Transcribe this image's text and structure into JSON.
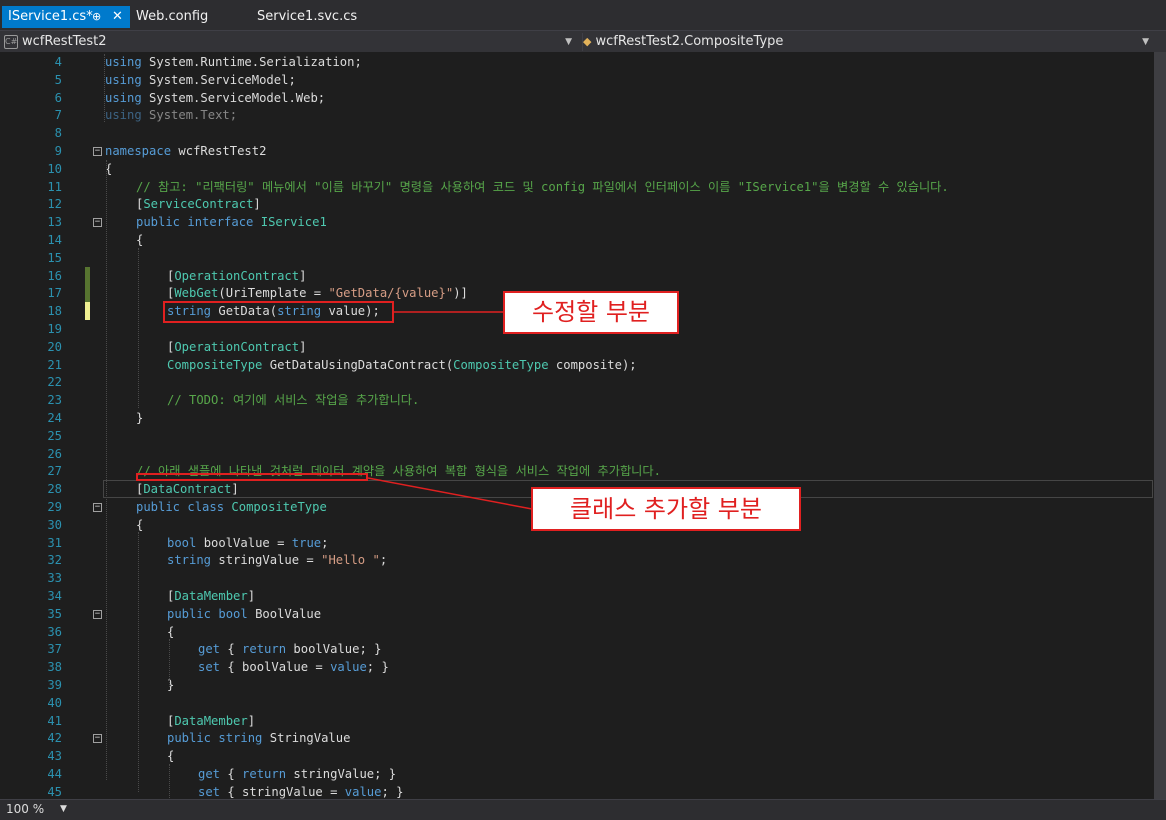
{
  "tabs": [
    {
      "label": "IService1.cs*",
      "pin": "⊕",
      "close": "✕",
      "active": true
    },
    {
      "label": "Web.config",
      "active": false
    },
    {
      "label": "Service1.svc.cs",
      "active": false
    }
  ],
  "navbar": {
    "project": "wcfRestTest2",
    "member": "wcfRestTest2.CompositeType",
    "project_icon": "csharp-project-icon",
    "member_icon": "class-icon"
  },
  "code_lines": [
    {
      "n": "4",
      "indent": 0,
      "parts": [
        [
          "kw",
          "using"
        ],
        [
          "",
          "System.Runtime.Serialization;"
        ]
      ]
    },
    {
      "n": "5",
      "indent": 0,
      "parts": [
        [
          "kw",
          "using"
        ],
        [
          "",
          "System.ServiceModel;"
        ]
      ]
    },
    {
      "n": "6",
      "indent": 0,
      "parts": [
        [
          "kw",
          "using"
        ],
        [
          "",
          "System.ServiceModel.Web;"
        ]
      ]
    },
    {
      "n": "7",
      "indent": 0,
      "dim": true,
      "parts": [
        [
          "kw",
          "using"
        ],
        [
          "",
          "System.Text;"
        ]
      ]
    },
    {
      "n": "8",
      "indent": 0,
      "parts": []
    },
    {
      "n": "9",
      "indent": 0,
      "fold": "-",
      "parts": [
        [
          "kw",
          "namespace"
        ],
        [
          "",
          "wcfRestTest2"
        ]
      ]
    },
    {
      "n": "10",
      "indent": 0,
      "parts": [
        [
          "",
          "{"
        ]
      ]
    },
    {
      "n": "11",
      "indent": 4,
      "parts": [
        [
          "cm",
          "// 참고: \"리팩터링\" 메뉴에서 \"이름 바꾸기\" 명령을 사용하여 코드 및 config 파일에서 인터페이스 이름 \"IService1\"을 변경할 수 있습니다."
        ]
      ]
    },
    {
      "n": "12",
      "indent": 4,
      "parts": [
        [
          "",
          "["
        ],
        [
          "ty",
          "ServiceContract"
        ],
        [
          "",
          "]"
        ]
      ]
    },
    {
      "n": "13",
      "indent": 4,
      "fold": "-",
      "parts": [
        [
          "kw",
          "public interface"
        ],
        [
          "ty",
          "IService1"
        ]
      ]
    },
    {
      "n": "14",
      "indent": 4,
      "parts": [
        [
          "",
          "{"
        ]
      ]
    },
    {
      "n": "15",
      "indent": 8,
      "parts": []
    },
    {
      "n": "16",
      "indent": 8,
      "change": "saved",
      "parts": [
        [
          "",
          "["
        ],
        [
          "ty",
          "OperationContract"
        ],
        [
          "",
          "]"
        ]
      ]
    },
    {
      "n": "17",
      "indent": 8,
      "change": "saved",
      "parts": [
        [
          "",
          "["
        ],
        [
          "ty",
          "WebGet"
        ],
        [
          "",
          "(UriTemplate ="
        ],
        [
          "st",
          "\"GetData/{value}\""
        ],
        [
          "",
          ")]"
        ]
      ]
    },
    {
      "n": "18",
      "indent": 8,
      "change": "unsaved",
      "parts": [
        [
          "kw",
          "string"
        ],
        [
          "",
          "GetData("
        ],
        [
          "kw",
          "string"
        ],
        [
          "",
          "value);"
        ]
      ]
    },
    {
      "n": "19",
      "indent": 8,
      "parts": []
    },
    {
      "n": "20",
      "indent": 8,
      "parts": [
        [
          "",
          "["
        ],
        [
          "ty",
          "OperationContract"
        ],
        [
          "",
          "]"
        ]
      ]
    },
    {
      "n": "21",
      "indent": 8,
      "parts": [
        [
          "ty",
          "CompositeType"
        ],
        [
          "",
          "GetDataUsingDataContract("
        ],
        [
          "ty",
          "CompositeType"
        ],
        [
          "",
          "composite);"
        ]
      ]
    },
    {
      "n": "22",
      "indent": 8,
      "parts": []
    },
    {
      "n": "23",
      "indent": 8,
      "parts": [
        [
          "cm",
          "// TODO: 여기에 서비스 작업을 추가합니다."
        ]
      ]
    },
    {
      "n": "24",
      "indent": 4,
      "parts": [
        [
          "",
          "}"
        ]
      ]
    },
    {
      "n": "25",
      "indent": 4,
      "parts": []
    },
    {
      "n": "26",
      "indent": 4,
      "parts": []
    },
    {
      "n": "27",
      "indent": 4,
      "parts": [
        [
          "cm",
          "// 아래 샘플에 나타낸 것처럼 데이터 계약을 사용하여 복합 형식을 서비스 작업에 추가합니다."
        ]
      ]
    },
    {
      "n": "28",
      "indent": 4,
      "parts": [
        [
          "",
          "["
        ],
        [
          "ty",
          "DataContract"
        ],
        [
          "",
          "]"
        ]
      ]
    },
    {
      "n": "29",
      "indent": 4,
      "fold": "-",
      "parts": [
        [
          "kw",
          "public class"
        ],
        [
          "ty",
          "CompositeType"
        ]
      ]
    },
    {
      "n": "30",
      "indent": 4,
      "parts": [
        [
          "",
          "{"
        ]
      ]
    },
    {
      "n": "31",
      "indent": 8,
      "parts": [
        [
          "kw",
          "bool"
        ],
        [
          "",
          "boolValue ="
        ],
        [
          "kw",
          "true"
        ],
        [
          "",
          ";"
        ]
      ]
    },
    {
      "n": "32",
      "indent": 8,
      "parts": [
        [
          "kw",
          "string"
        ],
        [
          "",
          "stringValue ="
        ],
        [
          "st",
          "\"Hello \""
        ],
        [
          "",
          ";"
        ]
      ]
    },
    {
      "n": "33",
      "indent": 8,
      "parts": []
    },
    {
      "n": "34",
      "indent": 8,
      "parts": [
        [
          "",
          "["
        ],
        [
          "ty",
          "DataMember"
        ],
        [
          "",
          "]"
        ]
      ]
    },
    {
      "n": "35",
      "indent": 8,
      "fold": "-",
      "parts": [
        [
          "kw",
          "public bool"
        ],
        [
          "",
          "BoolValue"
        ]
      ]
    },
    {
      "n": "36",
      "indent": 8,
      "parts": [
        [
          "",
          "{"
        ]
      ]
    },
    {
      "n": "37",
      "indent": 12,
      "parts": [
        [
          "kw",
          "get"
        ],
        [
          "",
          "{"
        ],
        [
          "kw",
          "return"
        ],
        [
          "",
          "boolValue; }"
        ]
      ]
    },
    {
      "n": "38",
      "indent": 12,
      "parts": [
        [
          "kw",
          "set"
        ],
        [
          "",
          "{ boolValue ="
        ],
        [
          "kw",
          "value"
        ],
        [
          "",
          "; }"
        ]
      ]
    },
    {
      "n": "39",
      "indent": 8,
      "parts": [
        [
          "",
          "}"
        ]
      ]
    },
    {
      "n": "40",
      "indent": 8,
      "parts": []
    },
    {
      "n": "41",
      "indent": 8,
      "parts": [
        [
          "",
          "["
        ],
        [
          "ty",
          "DataMember"
        ],
        [
          "",
          "]"
        ]
      ]
    },
    {
      "n": "42",
      "indent": 8,
      "fold": "-",
      "parts": [
        [
          "kw",
          "public string"
        ],
        [
          "",
          "StringValue"
        ]
      ]
    },
    {
      "n": "43",
      "indent": 8,
      "parts": [
        [
          "",
          "{"
        ]
      ]
    },
    {
      "n": "44",
      "indent": 12,
      "parts": [
        [
          "kw",
          "get"
        ],
        [
          "",
          "{"
        ],
        [
          "kw",
          "return"
        ],
        [
          "",
          "stringValue; }"
        ]
      ]
    },
    {
      "n": "45",
      "indent": 12,
      "parts": [
        [
          "kw",
          "set"
        ],
        [
          "",
          "{ stringValue ="
        ],
        [
          "kw",
          "value"
        ],
        [
          "",
          "; }"
        ]
      ]
    }
  ],
  "annotations": {
    "modify_label": "수정할 부분",
    "add_class_label": "클래스 추가할 부분"
  },
  "colors": {
    "accent": "#007acc",
    "annotation": "#e02020",
    "keyword": "#569cd6",
    "type": "#4ec9b0",
    "comment": "#57a64a",
    "string": "#d69d85",
    "line_number": "#2b91af",
    "change_saved": "#577430",
    "change_unsaved": "#efef91"
  },
  "statusbar": {
    "zoom": "100 %",
    "zoom_dropdown_icon": "dropdown-arrow-icon"
  }
}
